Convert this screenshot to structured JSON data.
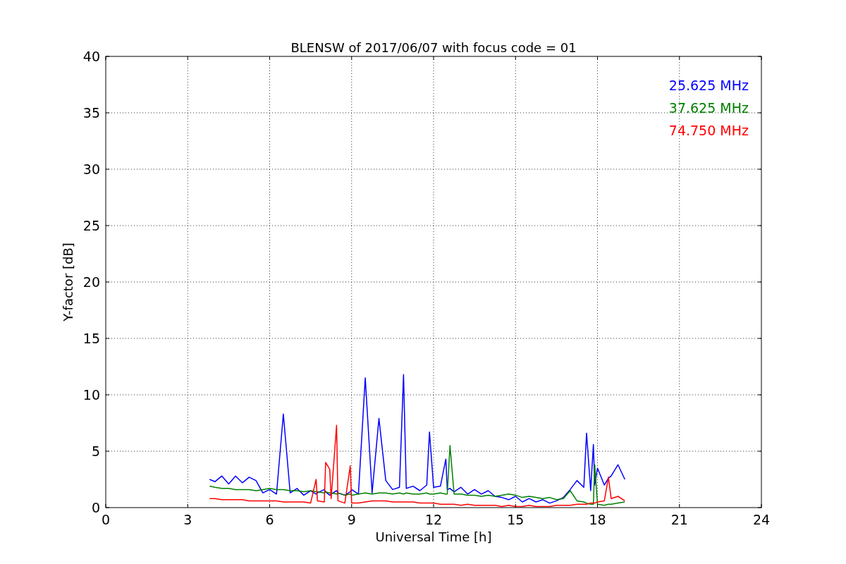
{
  "figure": {
    "chart_data": {
      "type": "line",
      "title": "BLENSW of 2017/06/07 with focus code = 01",
      "xlabel": "Universal Time [h]",
      "ylabel": "Y-factor [dB]",
      "x": [
        3.8,
        4.0,
        4.25,
        4.5,
        4.75,
        5.0,
        5.25,
        5.5,
        5.75,
        6.0,
        6.25,
        6.5,
        6.75,
        7.0,
        7.25,
        7.5,
        7.7,
        7.75,
        8.0,
        8.05,
        8.2,
        8.25,
        8.45,
        8.5,
        8.75,
        8.95,
        9.0,
        9.25,
        9.5,
        9.75,
        10.0,
        10.25,
        10.5,
        10.75,
        10.9,
        11.0,
        11.25,
        11.5,
        11.75,
        11.85,
        12.0,
        12.25,
        12.45,
        12.5,
        12.6,
        12.75,
        13.0,
        13.25,
        13.5,
        13.75,
        14.0,
        14.25,
        14.5,
        14.75,
        15.0,
        15.25,
        15.5,
        15.75,
        16.0,
        16.25,
        16.5,
        16.75,
        17.0,
        17.25,
        17.5,
        17.6,
        17.75,
        17.85,
        17.9,
        18.0,
        18.25,
        18.4,
        18.5,
        18.75,
        19.0
      ],
      "series": [
        {
          "name": "25.625 MHz",
          "color": "#0000ff",
          "values": [
            2.5,
            2.3,
            2.8,
            2.1,
            2.8,
            2.2,
            2.7,
            2.4,
            1.3,
            1.6,
            1.2,
            8.3,
            1.3,
            1.7,
            1.1,
            1.5,
            1.2,
            1.3,
            1.6,
            1.4,
            1.1,
            1.2,
            1.5,
            1.3,
            1.1,
            1.4,
            1.6,
            1.2,
            11.5,
            1.3,
            7.9,
            2.4,
            1.6,
            1.8,
            11.8,
            1.7,
            1.9,
            1.5,
            2.0,
            6.7,
            1.8,
            1.9,
            4.3,
            1.6,
            1.7,
            1.4,
            1.8,
            1.2,
            1.6,
            1.2,
            1.5,
            1.0,
            0.9,
            0.7,
            1.0,
            0.5,
            0.8,
            0.5,
            0.7,
            0.4,
            0.6,
            0.9,
            1.6,
            2.4,
            1.8,
            6.6,
            1.5,
            5.6,
            2.0,
            3.5,
            2.0,
            2.6,
            2.8,
            3.8,
            2.5
          ]
        },
        {
          "name": "37.625 MHz",
          "color": "#008000",
          "values": [
            1.9,
            1.8,
            1.7,
            1.7,
            1.6,
            1.6,
            1.6,
            1.5,
            1.6,
            1.7,
            1.6,
            1.6,
            1.5,
            1.5,
            1.4,
            1.5,
            1.4,
            1.4,
            1.3,
            1.4,
            1.3,
            1.3,
            1.2,
            1.3,
            1.1,
            1.2,
            1.1,
            1.2,
            1.3,
            1.2,
            1.3,
            1.3,
            1.2,
            1.3,
            1.2,
            1.3,
            1.2,
            1.2,
            1.3,
            1.2,
            1.2,
            1.3,
            1.2,
            1.2,
            5.5,
            1.2,
            1.2,
            1.1,
            1.1,
            1.0,
            1.1,
            1.0,
            1.1,
            1.2,
            1.1,
            0.9,
            1.0,
            0.9,
            0.8,
            0.9,
            0.7,
            0.8,
            1.5,
            0.6,
            0.5,
            0.4,
            0.3,
            0.3,
            3.8,
            0.3,
            0.2,
            0.3,
            0.3,
            0.4,
            0.5
          ]
        },
        {
          "name": "74.750 MHz",
          "color": "#ff0000",
          "values": [
            0.8,
            0.8,
            0.7,
            0.7,
            0.7,
            0.7,
            0.6,
            0.6,
            0.6,
            0.6,
            0.6,
            0.5,
            0.5,
            0.5,
            0.5,
            0.4,
            2.5,
            0.6,
            0.5,
            4.0,
            3.4,
            0.8,
            7.3,
            0.6,
            0.4,
            3.7,
            0.4,
            0.4,
            0.5,
            0.6,
            0.6,
            0.6,
            0.5,
            0.5,
            0.5,
            0.5,
            0.5,
            0.4,
            0.4,
            0.4,
            0.4,
            0.3,
            0.3,
            0.3,
            0.3,
            0.3,
            0.2,
            0.3,
            0.2,
            0.2,
            0.2,
            0.2,
            0.1,
            0.2,
            0.1,
            0.1,
            0.2,
            0.1,
            0.1,
            0.1,
            0.2,
            0.2,
            0.2,
            0.3,
            0.3,
            0.3,
            0.4,
            0.4,
            0.4,
            0.5,
            0.6,
            2.7,
            0.8,
            1.0,
            0.6
          ]
        }
      ],
      "grid": true,
      "xlim": [
        0,
        24
      ],
      "ylim": [
        0,
        40
      ],
      "xticks": [
        0,
        3,
        6,
        9,
        12,
        15,
        18,
        21,
        24
      ],
      "yticks": [
        0,
        5,
        10,
        15,
        20,
        25,
        30,
        35,
        40
      ]
    }
  }
}
